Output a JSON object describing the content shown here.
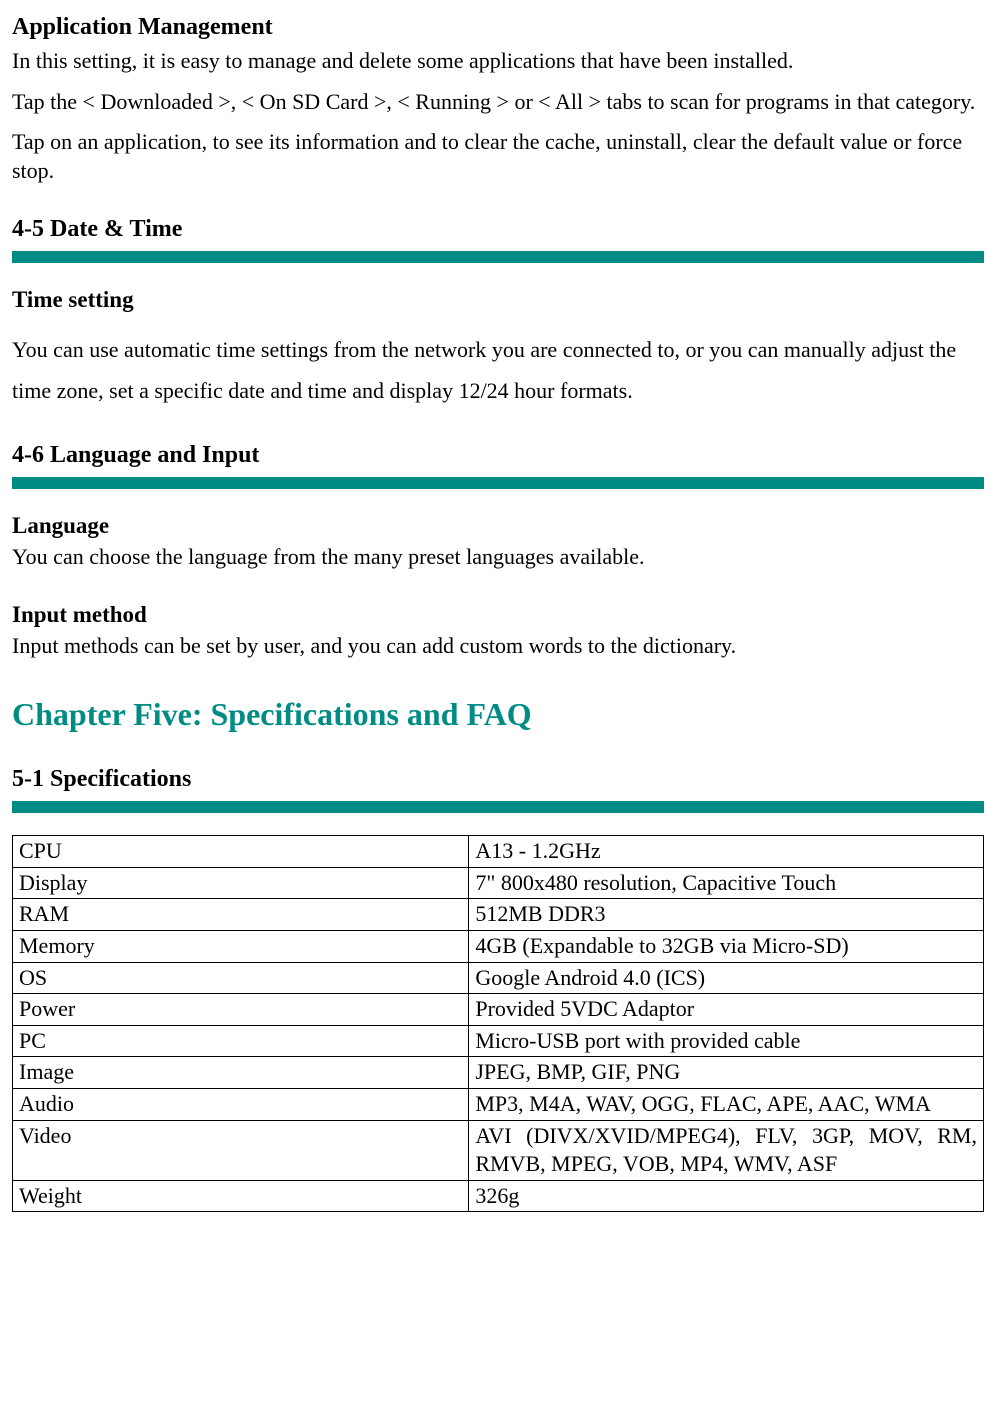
{
  "app_mgmt": {
    "title": "Application Management",
    "p1": "In this setting, it is easy to manage and delete some applications that have been installed.",
    "p2": "Tap the < Downloaded >, < On SD Card >, < Running > or < All > tabs to scan for programs in that category.",
    "p3": "Tap on an application, to see its information and to clear the cache, uninstall, clear the default value or force stop."
  },
  "date_time": {
    "heading": "4-5 Date & Time",
    "sub": "Time setting",
    "body": "You can use automatic time settings from the network you are connected to, or you can manually adjust the time zone, set a specific date and time and display 12/24 hour formats."
  },
  "lang_input": {
    "heading": "4-6 Language and Input",
    "lang_sub": "Language",
    "lang_body": "You can choose the language from the many preset languages available.",
    "input_sub": "Input method",
    "input_body": "Input methods can be set by user, and you can add custom words to the dictionary."
  },
  "chapter": {
    "title": "Chapter Five: Specifications and FAQ"
  },
  "specs": {
    "heading": "5-1 Specifications",
    "rows": [
      {
        "k": "CPU",
        "v": "A13 - 1.2GHz"
      },
      {
        "k": "Display",
        "v": "7\" 800x480 resolution, Capacitive Touch"
      },
      {
        "k": "RAM",
        "v": "512MB DDR3"
      },
      {
        "k": "Memory",
        "v": "4GB (Expandable to 32GB via Micro-SD)"
      },
      {
        "k": "OS",
        "v": "Google Android 4.0 (ICS)"
      },
      {
        "k": "Power",
        "v": "Provided 5VDC Adaptor"
      },
      {
        "k": "PC",
        "v": "Micro-USB port with provided cable"
      },
      {
        "k": "Image",
        "v": "JPEG, BMP, GIF, PNG"
      },
      {
        "k": "Audio",
        "v": "MP3, M4A, WAV, OGG, FLAC, APE, AAC, WMA"
      },
      {
        "k": "Video",
        "v": "AVI (DIVX/XVID/MPEG4), FLV, 3GP, MOV, RM, RMVB, MPEG, VOB, MP4, WMV, ASF"
      },
      {
        "k": "Weight",
        "v": "326g"
      }
    ]
  }
}
